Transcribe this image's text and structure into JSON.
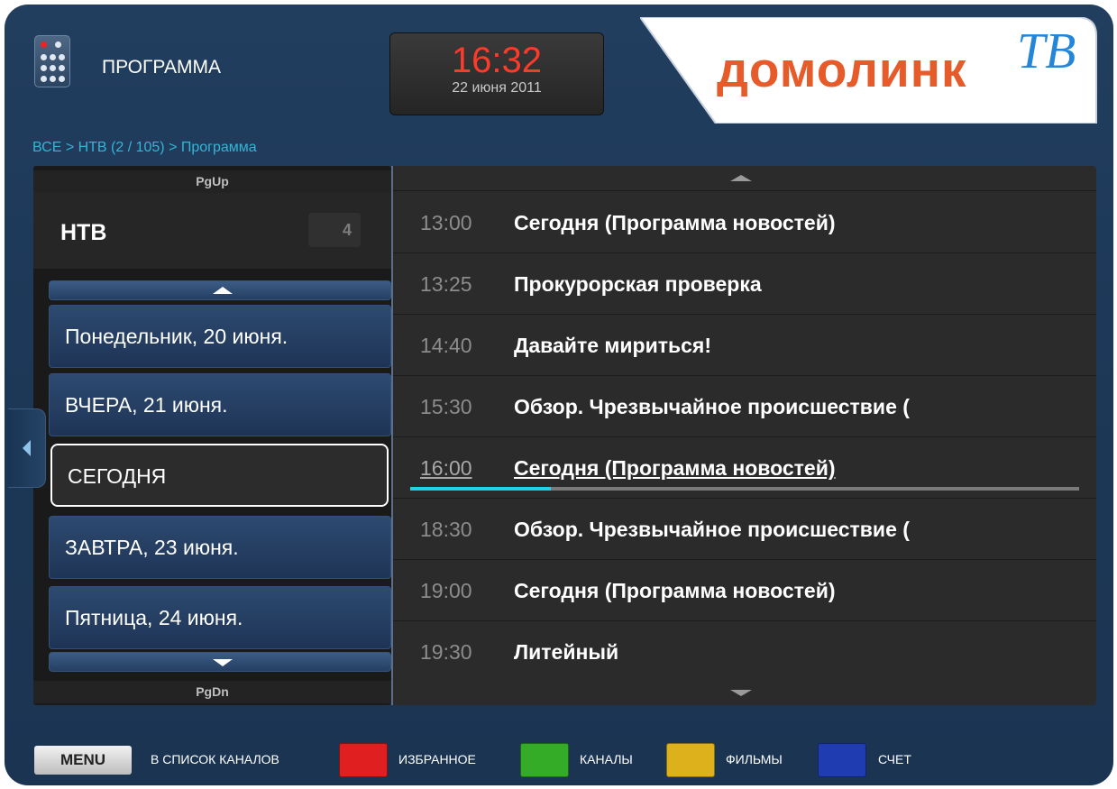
{
  "header": {
    "app_title": "ПРОГРАММА",
    "clock_time": "16:32",
    "clock_date": "22 июня 2011",
    "logo_word": "домолинк",
    "logo_tv": "ТВ"
  },
  "breadcrumb": "ВСЕ > НТВ (2 / 105) > Программа",
  "left": {
    "pgup_label": "PgUp",
    "pgdn_label": "PgDn",
    "channel_name": "НТВ",
    "channel_number": "4",
    "days": [
      {
        "label": "Понедельник, 20 июня.",
        "selected": false
      },
      {
        "label": "ВЧЕРА, 21 июня.",
        "selected": false
      },
      {
        "label": "СЕГОДНЯ",
        "selected": true
      },
      {
        "label": "ЗАВТРА, 23 июня.",
        "selected": false
      },
      {
        "label": "Пятница, 24 июня.",
        "selected": false
      }
    ]
  },
  "schedule": {
    "rows": [
      {
        "time": "13:00",
        "title": "Сегодня (Программа новостей)"
      },
      {
        "time": "13:25",
        "title": "Прокурорская проверка"
      },
      {
        "time": "14:40",
        "title": "Давайте мириться!"
      },
      {
        "time": "15:30",
        "title": "Обзор. Чрезвычайное происшествие ("
      },
      {
        "time": "16:00",
        "title": "Сегодня (Программа новостей)",
        "now": true
      },
      {
        "time": "18:30",
        "title": "Обзор. Чрезвычайное происшествие ("
      },
      {
        "time": "19:00",
        "title": "Сегодня (Программа новостей)"
      },
      {
        "time": "19:30",
        "title": "Литейный"
      }
    ],
    "now_progress": 0.21
  },
  "footer": {
    "menu_label": "MENU",
    "menu_action": "В СПИСОК КАНАЛОВ",
    "red_label": "ИЗБРАННОЕ",
    "green_label": "КАНАЛЫ",
    "yellow_label": "ФИЛЬМЫ",
    "blue_label": "СЧЕТ"
  },
  "colors": {
    "red": "#e02020",
    "green": "#35ac28",
    "yellow": "#dcb11c",
    "blue": "#1f3db0",
    "accent_progress": "#1fd2e8",
    "clock_red": "#ff3a29",
    "logo_orange": "#e75a2a",
    "logo_blue": "#2486d8"
  }
}
